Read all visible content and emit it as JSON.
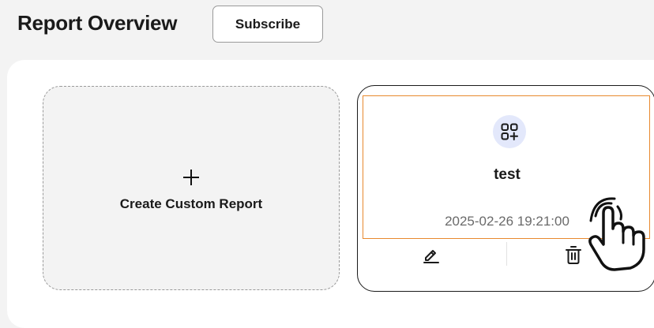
{
  "header": {
    "title": "Report Overview",
    "subscribe_label": "Subscribe"
  },
  "create_card": {
    "icon": "plus-icon",
    "label": "Create Custom Report"
  },
  "report_card": {
    "icon": "add-grid-icon",
    "name": "test",
    "date": "2025-02-26 19:21:00",
    "actions": {
      "edit_icon": "pencil-icon",
      "delete_icon": "trash-icon"
    }
  },
  "colors": {
    "background": "#f3f3f3",
    "highlight": "#e8892e",
    "icon_circle": "#e3e8fb",
    "date_text": "#6a6a6a"
  }
}
